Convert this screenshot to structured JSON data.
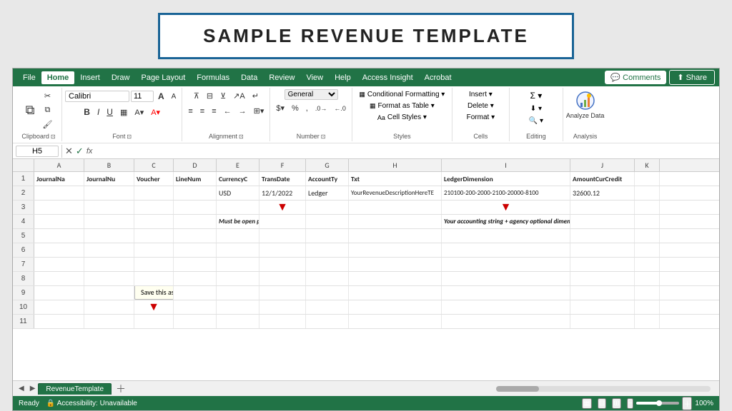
{
  "title": "SAMPLE REVENUE TEMPLATE",
  "menu": {
    "items": [
      "File",
      "Home",
      "Insert",
      "Draw",
      "Page Layout",
      "Formulas",
      "Data",
      "Review",
      "View",
      "Help",
      "Access Insight",
      "Acrobat"
    ],
    "active": "Home",
    "right": {
      "comments": "💬 Comments",
      "share": "⬆ Share"
    }
  },
  "toolbar": {
    "clipboard": {
      "paste": "Paste",
      "cut": "✂",
      "copy": "⧉",
      "format_painter": "🖌",
      "label": "Clipboard"
    },
    "font": {
      "name": "Calibri",
      "size": "11",
      "grow": "A",
      "shrink": "A",
      "bold": "B",
      "italic": "I",
      "underline": "U",
      "label": "Font"
    },
    "alignment": {
      "label": "Alignment"
    },
    "number": {
      "format": "General",
      "label": "Number"
    },
    "styles": {
      "conditional": "Conditional Formatting ▾",
      "table": "Format as Table ▾",
      "cell": "Cell Styles ▾",
      "label": "Styles"
    },
    "cells": {
      "insert": "Insert ▾",
      "delete": "Delete ▾",
      "format": "Format ▾",
      "label": "Cells"
    },
    "editing": {
      "sum": "Σ ▾",
      "fill": "⬇ ▾",
      "clear": "🔍 ▾",
      "label": "Editing"
    },
    "analysis": {
      "label": "Analyze Data",
      "group_label": "Analysis"
    }
  },
  "formula_bar": {
    "cell_ref": "H5",
    "formula": ""
  },
  "columns": [
    "A",
    "B",
    "C",
    "D",
    "E",
    "F",
    "G",
    "H",
    "I",
    "J",
    "K"
  ],
  "rows": [
    {
      "num": "1",
      "cells": [
        "JournalNa",
        "JournalNu",
        "Voucher",
        "LineNum",
        "CurrencyC",
        "TransDate",
        "AccountTy",
        "Txt",
        "",
        "LedgerDimension",
        "",
        "AmountCurCredit",
        ""
      ]
    },
    {
      "num": "2",
      "cells": [
        "",
        "",
        "",
        "",
        "USD",
        "12/1/2022",
        "Ledger",
        "YourRevenueDescriptionHereTE",
        "210100-200-2000-2100-20000-8100",
        "32600.12",
        ""
      ]
    },
    {
      "num": "3",
      "cells": [
        "",
        "",
        "",
        "",
        "",
        "▲",
        "",
        "",
        "▲",
        "",
        ""
      ]
    },
    {
      "num": "4",
      "cells": [
        "",
        "",
        "",
        "",
        "Must be open period",
        "",
        "",
        "",
        "Your accounting string + agency optional dimensions here",
        "",
        ""
      ]
    },
    {
      "num": "5",
      "cells": [
        "",
        "",
        "",
        "",
        "",
        "",
        "",
        "",
        "",
        "",
        ""
      ]
    },
    {
      "num": "6",
      "cells": [
        "",
        "",
        "",
        "",
        "",
        "",
        "",
        "",
        "",
        "",
        ""
      ]
    },
    {
      "num": "7",
      "cells": [
        "",
        "",
        "",
        "",
        "",
        "",
        "",
        "",
        "",
        "",
        ""
      ]
    },
    {
      "num": "8",
      "cells": [
        "",
        "",
        "",
        "",
        "",
        "",
        "",
        "",
        "",
        "",
        ""
      ]
    },
    {
      "num": "9",
      "cells": [
        "",
        "",
        "Save this as CSV file",
        "",
        "",
        "",
        "",
        "",
        "",
        "",
        ""
      ]
    },
    {
      "num": "10",
      "cells": [
        "",
        "",
        "",
        "",
        "",
        "",
        "",
        "",
        "",
        "",
        ""
      ]
    },
    {
      "num": "11",
      "cells": [
        "",
        "",
        "",
        "",
        "",
        "",
        "",
        "",
        "",
        "",
        ""
      ]
    }
  ],
  "arrow_row3_f": "▼",
  "arrow_row3_i": "▼",
  "arrow_row10_c": "▼",
  "sheet_tab": "RevenueTemplate",
  "status": {
    "ready": "Ready",
    "accessibility": "🔒 Accessibility: Unavailable",
    "zoom": "100%",
    "view_normal": "▦",
    "view_page": "⊟",
    "view_layout": "⊞"
  }
}
